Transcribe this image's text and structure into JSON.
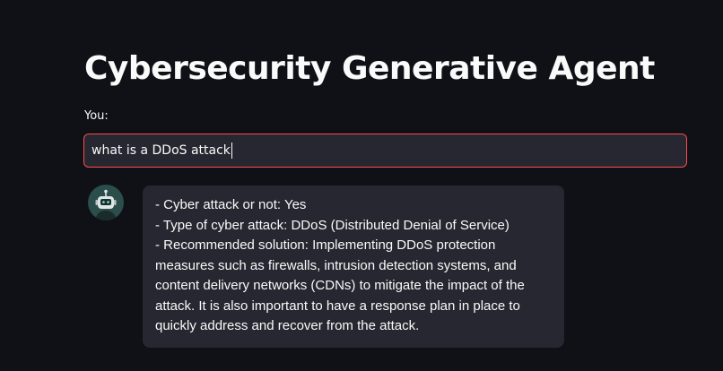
{
  "header": {
    "title": "Cybersecurity Generative Agent"
  },
  "input": {
    "label": "You:",
    "value": "what is a DDoS attack"
  },
  "chat": {
    "assistant_avatar_icon": "robot-icon",
    "response_lines": [
      "- Cyber attack or not: Yes",
      "- Type of cyber attack: DDoS (Distributed Denial of Service)",
      "- Recommended solution: Implementing DDoS protection measures such as firewalls, intrusion detection systems, and content delivery networks (CDNs) to mitigate the impact of the attack. It is also important to have a response plan in place to quickly address and recover from the attack."
    ]
  },
  "colors": {
    "background": "#0f1117",
    "input_border": "#ff4b4b",
    "surface": "#262730",
    "text": "#fafafa"
  }
}
